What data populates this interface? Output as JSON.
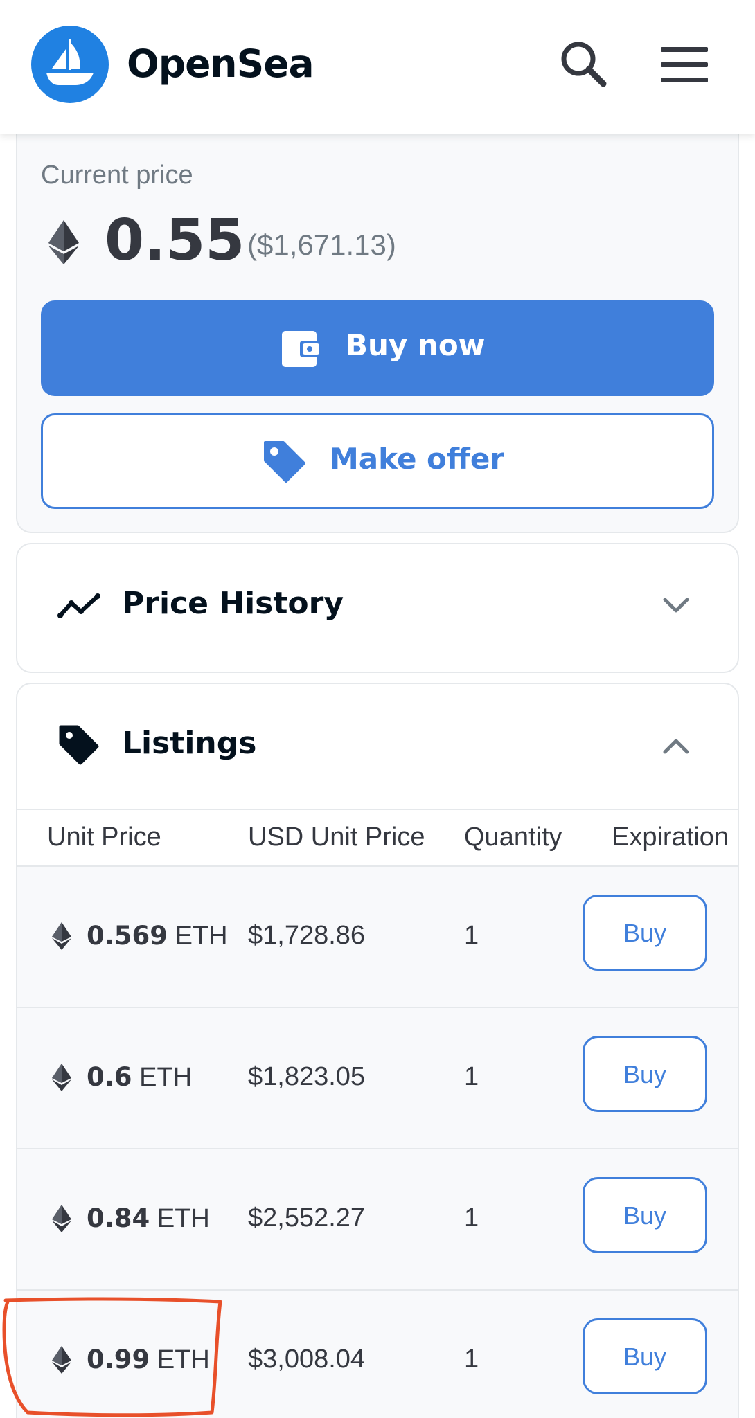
{
  "header": {
    "brand": "OpenSea",
    "icons": [
      "opensea-logo-icon",
      "search-icon",
      "menu-icon"
    ]
  },
  "price": {
    "label": "Current price",
    "value": "0.55",
    "usd": "($1,671.13)",
    "buy_now": "Buy now",
    "make_offer": "Make offer"
  },
  "price_history": {
    "title": "Price History"
  },
  "listings": {
    "title": "Listings",
    "columns": [
      "Unit Price",
      "USD Unit Price",
      "Quantity",
      "Expiration"
    ],
    "rows": [
      {
        "amount": "0.569",
        "unit": "ETH",
        "usd": "$1,728.86",
        "quantity": "1",
        "action": "Buy"
      },
      {
        "amount": "0.6",
        "unit": "ETH",
        "usd": "$1,823.05",
        "quantity": "1",
        "action": "Buy"
      },
      {
        "amount": "0.84",
        "unit": "ETH",
        "usd": "$2,552.27",
        "quantity": "1",
        "action": "Buy"
      },
      {
        "amount": "0.99",
        "unit": "ETH",
        "usd": "$3,008.04",
        "quantity": "1",
        "action": "Buy"
      }
    ]
  },
  "colors": {
    "accent": "#407FDB",
    "brand": "#2081E2",
    "annotation": "#E8502A"
  }
}
